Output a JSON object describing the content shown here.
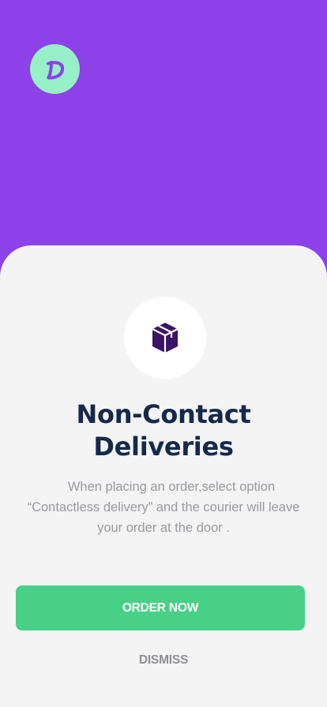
{
  "colors": {
    "header_background": "#8c41e9",
    "logo_background": "#98f0c8",
    "logo_letter": "#8c41e9",
    "sheet_background": "#f4f4f5",
    "title_text": "#15294b",
    "body_text": "#9a9a9f",
    "primary_button": "#48d186",
    "package_icon": "#3b1466"
  },
  "brand": {
    "logo_icon": "d-logo-icon"
  },
  "onboarding": {
    "illustration_icon": "package-box-icon",
    "title_line1": "Non-Contact",
    "title_line2": "Deliveries",
    "description_line1": "When placing an order,select option",
    "description_line2": "“Contactless delivery” and the courier will leave",
    "description_line3": "your order at the door ."
  },
  "actions": {
    "order_now_label": "ORDER NOW",
    "dismiss_label": "DISMISS"
  }
}
